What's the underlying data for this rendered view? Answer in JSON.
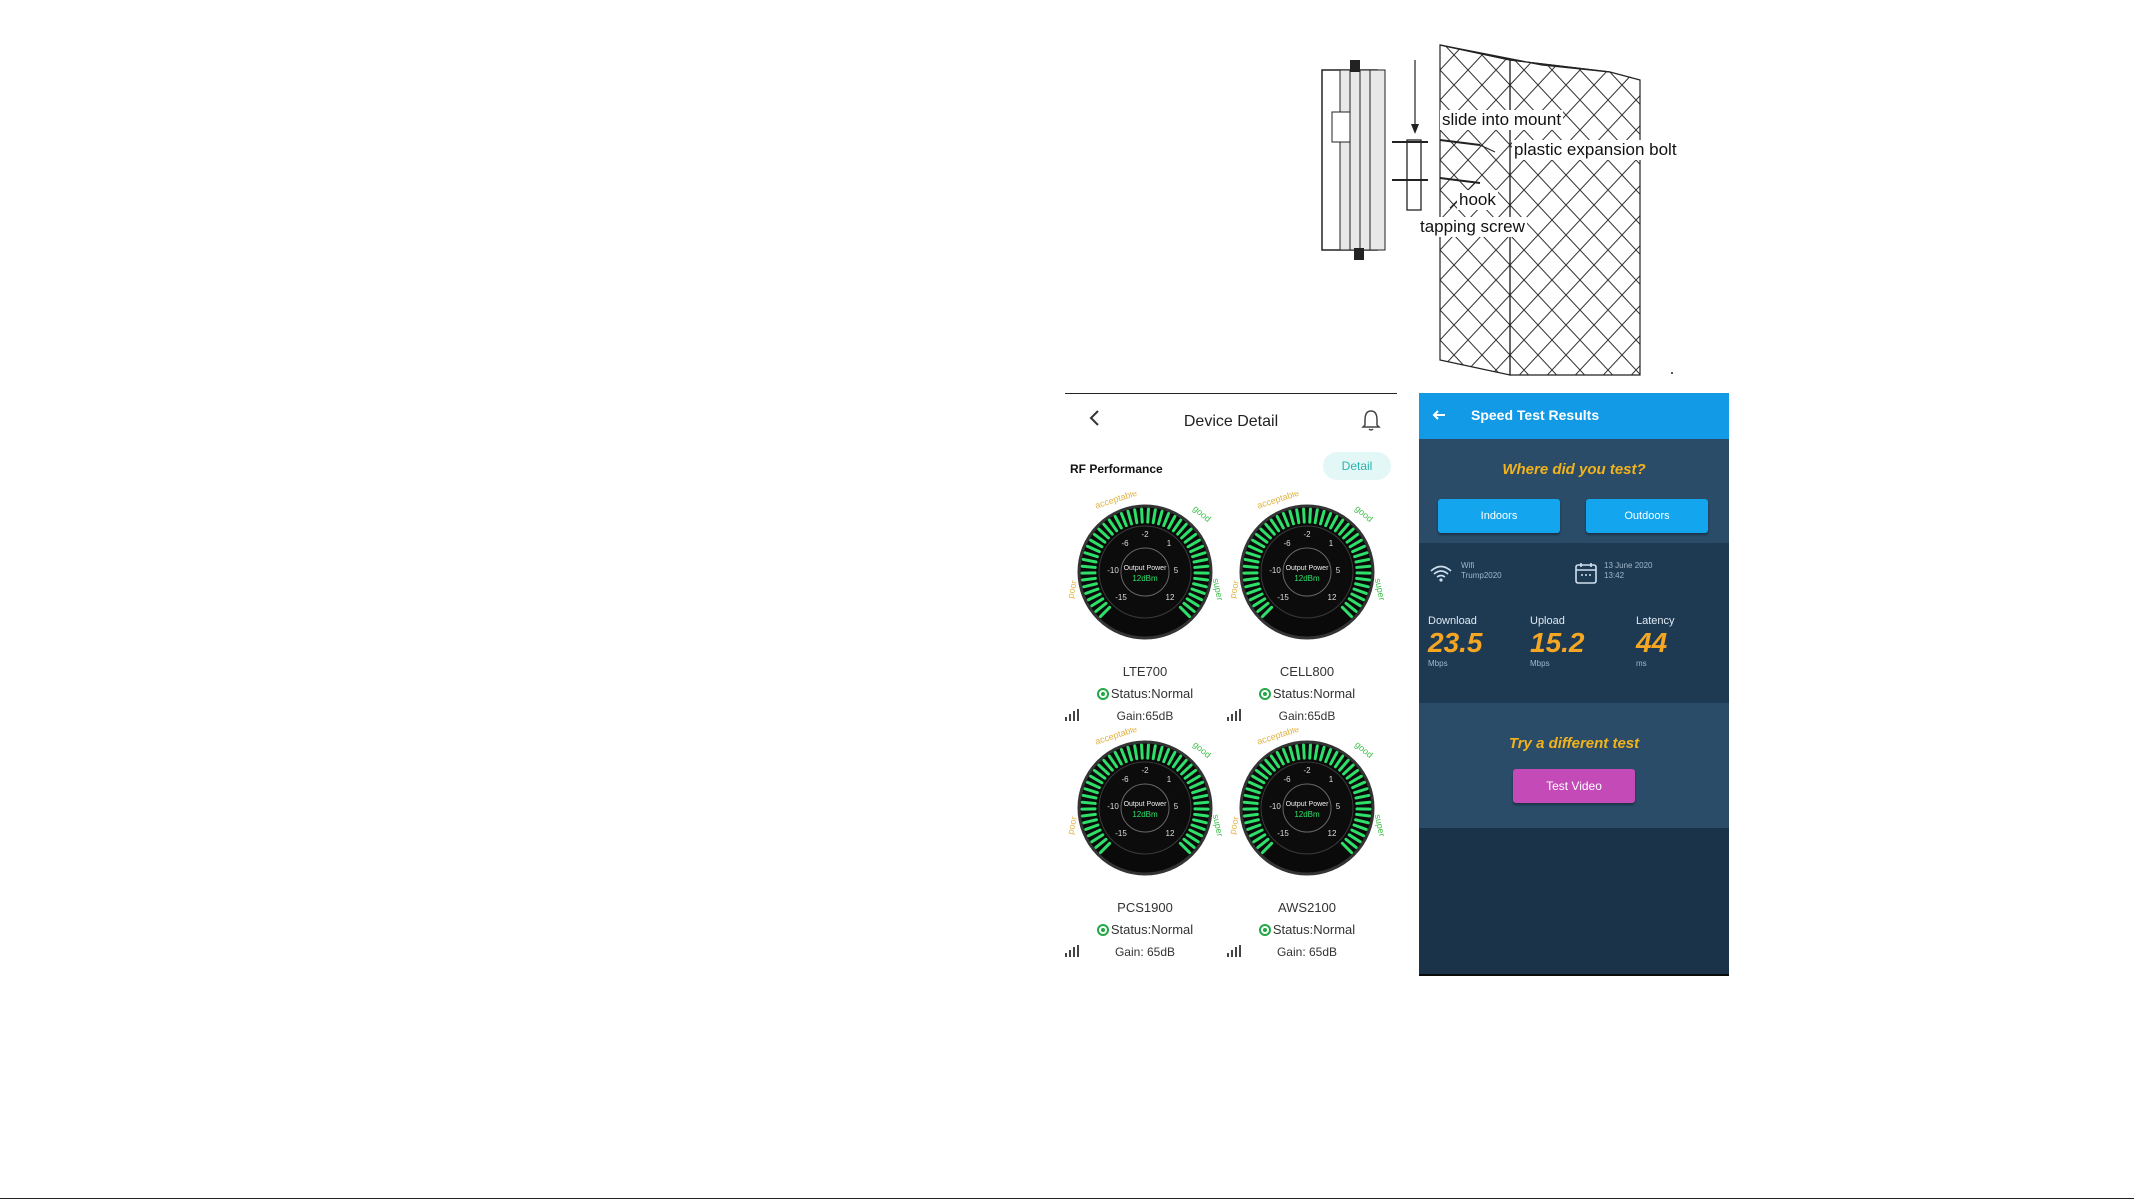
{
  "diagram": {
    "labels": {
      "slide": "slide into mount",
      "bolt": "plastic expansion bolt",
      "hook": "hook",
      "screw": "tapping screw"
    }
  },
  "device_detail": {
    "title": "Device Detail",
    "section_title": "RF Performance",
    "detail_button": "Detail",
    "gauge_text": {
      "caption": "Output Power",
      "value": "12dBm",
      "scale": [
        "-2",
        "-6",
        "1",
        "-10",
        "5",
        "-15",
        "12"
      ],
      "zones": [
        "acceptable",
        "good",
        "poor",
        "super"
      ]
    },
    "bands": [
      {
        "name": "LTE700",
        "status": "Status:Normal",
        "gain": "Gain:65dB"
      },
      {
        "name": "CELL800",
        "status": "Status:Normal",
        "gain": "Gain:65dB"
      },
      {
        "name": "PCS1900",
        "status": "Status:Normal",
        "gain": "Gain: 65dB"
      },
      {
        "name": "AWS2100",
        "status": "Status:Normal",
        "gain": "Gain: 65dB"
      }
    ]
  },
  "speed_test": {
    "title": "Speed Test Results",
    "question": "Where did you test?",
    "indoors": "Indoors",
    "outdoors": "Outdoors",
    "wifi_label": "Wifi",
    "wifi_name": "Trump2020",
    "date": "13 June 2020",
    "time": "13:42",
    "download": {
      "label": "Download",
      "value": "23.5",
      "unit": "Mbps"
    },
    "upload": {
      "label": "Upload",
      "value": "15.2",
      "unit": "Mbps"
    },
    "latency": {
      "label": "Latency",
      "value": "44",
      "unit": "ms"
    },
    "try_title": "Try a different test",
    "test_video": "Test Video"
  },
  "colors": {
    "accent_blue": "#139ae6",
    "gauge_green": "#2ee06a",
    "speed_orange": "#f5a623",
    "video_pink": "#c34ab7"
  }
}
